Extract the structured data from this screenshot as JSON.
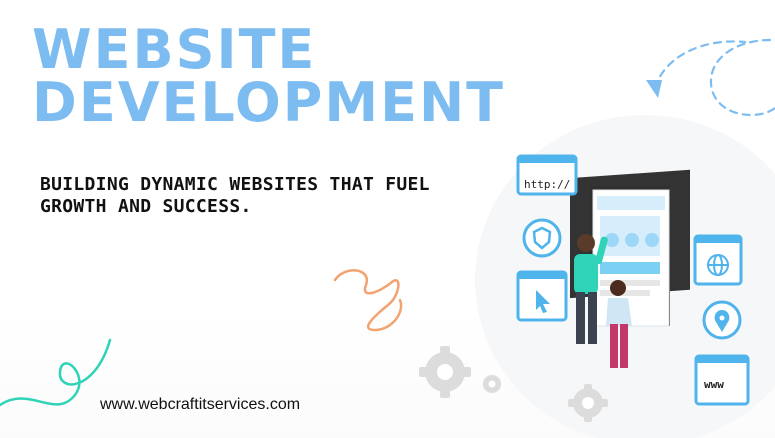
{
  "title": {
    "line1": "WEBSITE",
    "line2": "DEVELOPMENT"
  },
  "subtitle": "BUILDING DYNAMIC WEBSITES THAT FUEL GROWTH AND SUCCESS.",
  "website": "www.webcraftitservices.com",
  "illustration": {
    "http_card": "http://",
    "www_card": "www",
    "icons": [
      "shield-icon",
      "globe-icon",
      "cursor-icon",
      "pin-icon",
      "gear-icon"
    ]
  },
  "colors": {
    "title": "#7cbcf0",
    "accent_blue": "#4fb3ec",
    "teal_squiggle": "#2fd3b8",
    "orange_squiggle": "#f2a36f",
    "gear_gray": "#d7d7d7"
  }
}
